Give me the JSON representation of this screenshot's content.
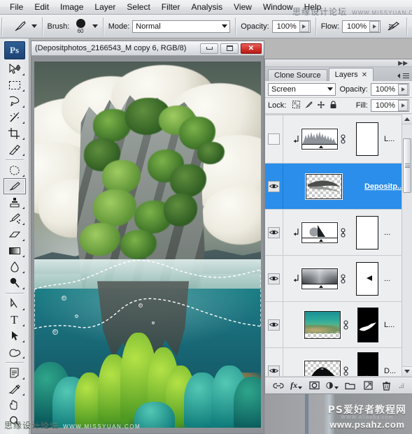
{
  "app": {
    "name": "Adobe Photoshop",
    "logo_text": "Ps"
  },
  "menubar": {
    "items": [
      {
        "label": "File"
      },
      {
        "label": "Edit"
      },
      {
        "label": "Image"
      },
      {
        "label": "Layer"
      },
      {
        "label": "Select"
      },
      {
        "label": "Filter"
      },
      {
        "label": "Analysis"
      },
      {
        "label": "View"
      },
      {
        "label": "Window"
      },
      {
        "label": "Help"
      }
    ]
  },
  "options_bar": {
    "tool_icon": "brush-tool-icon",
    "brush_label": "Brush:",
    "brush_size": "60",
    "mode_label": "Mode:",
    "mode_value": "Normal",
    "opacity_label": "Opacity:",
    "opacity_value": "100%",
    "flow_label": "Flow:",
    "flow_value": "100%",
    "airbrush_icon": "airbrush-icon"
  },
  "toolbox": {
    "tools": [
      {
        "name": "move-tool",
        "group": 1
      },
      {
        "name": "rectangular-marquee-tool",
        "group": 1
      },
      {
        "name": "lasso-tool",
        "group": 1
      },
      {
        "name": "magic-wand-tool",
        "group": 1
      },
      {
        "name": "crop-tool",
        "group": 1
      },
      {
        "name": "slice-tool",
        "group": 1
      },
      {
        "name": "patch-tool",
        "group": 2
      },
      {
        "name": "brush-tool",
        "group": 2,
        "selected": true
      },
      {
        "name": "clone-stamp-tool",
        "group": 2
      },
      {
        "name": "history-brush-tool",
        "group": 2
      },
      {
        "name": "eraser-tool",
        "group": 2
      },
      {
        "name": "gradient-tool",
        "group": 2
      },
      {
        "name": "blur-tool",
        "group": 2
      },
      {
        "name": "dodge-tool",
        "group": 2
      },
      {
        "name": "pen-tool",
        "group": 3
      },
      {
        "name": "type-tool",
        "group": 3
      },
      {
        "name": "path-selection-tool",
        "group": 3
      },
      {
        "name": "custom-shape-tool",
        "group": 3
      },
      {
        "name": "notes-tool",
        "group": 4
      },
      {
        "name": "eyedropper-tool",
        "group": 4
      },
      {
        "name": "hand-tool",
        "group": 4
      },
      {
        "name": "zoom-tool",
        "group": 4
      }
    ]
  },
  "document": {
    "title": "(Depositphotos_2166543_M copy 6, RGB/8)",
    "window_buttons": {
      "minimize": "minimize-button",
      "maximize": "maximize-button",
      "close_label": "✕"
    },
    "artwork_description": "Limestone karst island above water with coral reef below a marching-ants selection at the waterline"
  },
  "panel": {
    "tabs": [
      {
        "label": "Clone Source",
        "active": false,
        "closable": false
      },
      {
        "label": "Layers",
        "active": true,
        "closable": true,
        "close_glyph": "✕"
      }
    ],
    "menu_icon": "panel-menu-icon",
    "blend_mode": "Screen",
    "opacity_label": "Opacity:",
    "opacity_value": "100%",
    "lock_label": "Lock:",
    "lock_icons": [
      "lock-transparent-pixels-icon",
      "lock-image-pixels-icon",
      "lock-position-icon",
      "lock-all-icon"
    ],
    "fill_label": "Fill:",
    "fill_value": "100%",
    "layers": [
      {
        "name": "L...",
        "visible": false,
        "selected": false,
        "clipped": true,
        "thumb_kind": "levels-adjustment",
        "has_mask": true,
        "mask_kind": "white",
        "linked": true
      },
      {
        "name": "Depositp...",
        "visible": true,
        "selected": true,
        "clipped": false,
        "thumb_kind": "transparent-streak",
        "has_mask": false,
        "linked": false
      },
      {
        "name": "...",
        "visible": true,
        "selected": false,
        "clipped": true,
        "thumb_kind": "curves-adjustment",
        "has_mask": true,
        "mask_kind": "white",
        "linked": true
      },
      {
        "name": "...",
        "visible": true,
        "selected": false,
        "clipped": true,
        "thumb_kind": "gradient-adjustment",
        "has_mask": true,
        "mask_kind": "white-with-black-mark",
        "linked": true
      },
      {
        "name": "L...",
        "visible": true,
        "selected": false,
        "clipped": false,
        "thumb_kind": "reef-photo",
        "has_mask": true,
        "mask_kind": "black-with-white-streak",
        "linked": true
      },
      {
        "name": "D...",
        "visible": true,
        "selected": false,
        "clipped": false,
        "thumb_kind": "black-silhouette",
        "has_mask": true,
        "mask_kind": "black-with-white-bottom",
        "linked": true
      }
    ],
    "scrollbar": {
      "up_arrow": "scroll-up-arrow",
      "down_arrow": "scroll-down-arrow",
      "thumb": "scroll-thumb"
    },
    "footer_buttons": [
      {
        "name": "link-layers-button",
        "glyph": "⊷"
      },
      {
        "name": "layer-style-button",
        "glyph": "fx"
      },
      {
        "name": "layer-mask-button",
        "glyph": "◉"
      },
      {
        "name": "new-fill-adjustment-button",
        "glyph": "◑"
      },
      {
        "name": "new-group-button",
        "glyph": "▭"
      },
      {
        "name": "new-layer-button",
        "glyph": "◲"
      },
      {
        "name": "delete-layer-button",
        "glyph": "🗑"
      }
    ]
  },
  "watermarks": {
    "top_cn": "思缘设计论坛",
    "top_en": "WWW.MISSYUAN.COM",
    "bottom_left_cn": "思缘设计论坛",
    "bottom_left_en": "WWW.MISSYUAN.COM",
    "bottom_right_faint": "WWW.Alibaba.com",
    "bottom_right_l1": "PS爱好者教程网",
    "bottom_right_l2": "www.psahz.com"
  },
  "colors": {
    "selection_blue": "#2a8eea",
    "panel_bg": "#eceef0",
    "chrome_bg": "#d4d6d9",
    "close_red": "#d0302a"
  }
}
